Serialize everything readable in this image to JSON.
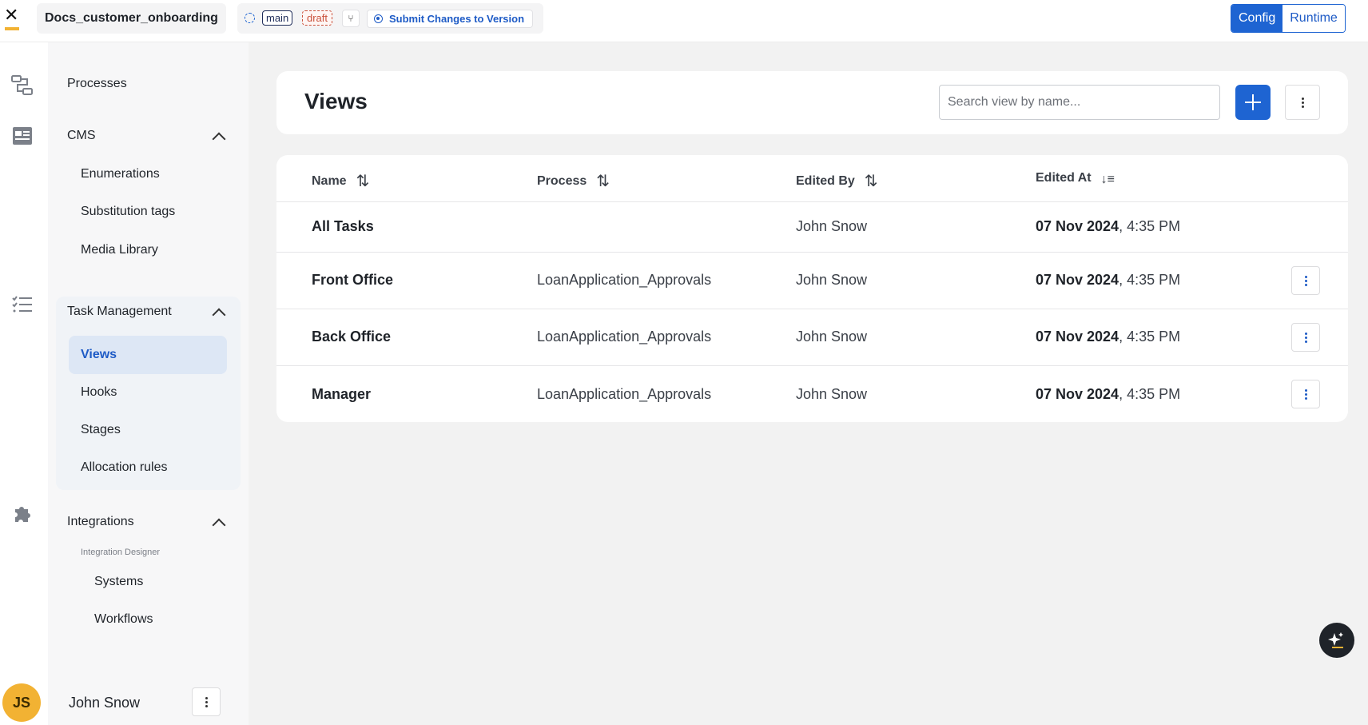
{
  "topbar": {
    "project_name": "Docs_customer_onboarding",
    "branch": "main",
    "status": "draft",
    "submit_label": "Submit Changes to Version",
    "modes": [
      "Config",
      "Runtime"
    ],
    "active_mode": "Config",
    "accent_color": "#1e64d2"
  },
  "rail": {
    "icons": [
      "process-flow-icon",
      "cms-icon",
      "task-list-icon",
      "puzzle-icon"
    ]
  },
  "sidemenu": {
    "processes": "Processes",
    "cms": {
      "label": "CMS",
      "items": [
        "Enumerations",
        "Substitution tags",
        "Media Library"
      ]
    },
    "task_management": {
      "label": "Task Management",
      "items": [
        "Views",
        "Hooks",
        "Stages",
        "Allocation rules"
      ],
      "active": "Views"
    },
    "integrations": {
      "label": "Integrations",
      "section": "Integration Designer",
      "items": [
        "Systems",
        "Workflows"
      ]
    }
  },
  "user": {
    "initials": "JS",
    "name": "John Snow"
  },
  "views_page": {
    "title": "Views",
    "search_placeholder": "Search view by name...",
    "columns": {
      "name": "Name",
      "process": "Process",
      "edited_by": "Edited By",
      "edited_at": "Edited At"
    },
    "rows": [
      {
        "name": "All Tasks",
        "process": "",
        "edited_by": "John Snow",
        "date": "07 Nov 2024",
        "time": ", 4:35 PM"
      },
      {
        "name": "Front Office",
        "process": "LoanApplication_Approvals",
        "edited_by": "John Snow",
        "date": "07 Nov 2024",
        "time": ", 4:35 PM"
      },
      {
        "name": "Back Office",
        "process": "LoanApplication_Approvals",
        "edited_by": "John Snow",
        "date": "07 Nov 2024",
        "time": ", 4:35 PM"
      },
      {
        "name": "Manager",
        "process": "LoanApplication_Approvals",
        "edited_by": "John Snow",
        "date": "07 Nov 2024",
        "time": ", 4:35 PM"
      }
    ]
  }
}
